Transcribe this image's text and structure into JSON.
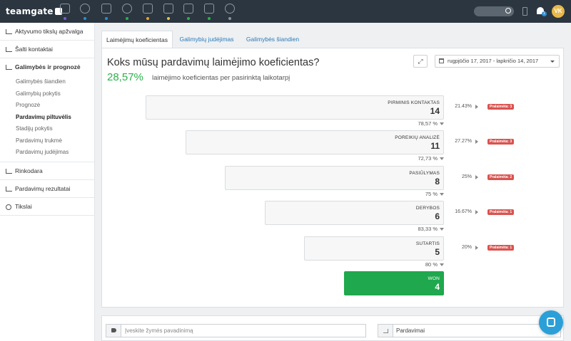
{
  "app": {
    "logo": "teamgate"
  },
  "topbar": {
    "nav_icons": [
      {
        "name": "dashboard-icon",
        "dot": "#7b5bd6"
      },
      {
        "name": "target-icon",
        "dot": "#2a8fd6"
      },
      {
        "name": "book-icon",
        "dot": "#2a8fd6"
      },
      {
        "name": "chart-pie-icon",
        "dot": "#2bb24c"
      },
      {
        "name": "briefcase-icon",
        "dot": "#e8a33a"
      },
      {
        "name": "calendar-icon",
        "dot": "#e8c93a"
      },
      {
        "name": "lock-icon",
        "dot": "#2bb24c"
      },
      {
        "name": "document-icon",
        "dot": "#2bb24c"
      },
      {
        "name": "globe-icon",
        "dot": "#8b96a1"
      }
    ],
    "notification_count": "1",
    "avatar_initials": "VK"
  },
  "sidebar": {
    "sections": [
      {
        "label": "Aktyvumo tikslų apžvalga"
      },
      {
        "label": "Šalti kontaktai"
      },
      {
        "label": "Galimybės ir prognozė",
        "items": [
          {
            "label": "Galimybės šiandien"
          },
          {
            "label": "Galimybių pokytis"
          },
          {
            "label": "Prognozė"
          },
          {
            "label": "Pardavimų piltuvėlis",
            "active": true
          },
          {
            "label": "Stadijų pokytis"
          },
          {
            "label": "Pardavimų trukmė"
          },
          {
            "label": "Pardavimų judėjimas"
          }
        ]
      },
      {
        "label": "Rinkodara"
      },
      {
        "label": "Pardavimų rezultatai"
      },
      {
        "label": "Tikslai"
      }
    ]
  },
  "tabs": [
    {
      "label": "Laimėjimų koeficientas",
      "active": true
    },
    {
      "label": "Galimybių judėjimas"
    },
    {
      "label": "Galimybės šiandien"
    }
  ],
  "panel": {
    "title": "Koks mūsų pardavimų laimėjimo koeficientas?",
    "win_rate": "28,57%",
    "win_rate_desc": "laimėjimo koeficientas per pasirinktą laikotarpį",
    "date_range": "rugpjūčio 17, 2017 - lapkričio 14, 2017"
  },
  "funnel": {
    "stages": [
      {
        "name": "PIRMINIS KONTAKTAS",
        "count": "14",
        "loss_pct": "21.43%",
        "lost": "Pralaimėta: 3"
      },
      {
        "name": "POREIKIŲ ANALIZĖ",
        "count": "11",
        "loss_pct": "27.27%",
        "lost": "Pralaimėta: 3"
      },
      {
        "name": "PASIŪLYMAS",
        "count": "8",
        "loss_pct": "25%",
        "lost": "Pralaimėta: 2"
      },
      {
        "name": "DERYBOS",
        "count": "6",
        "loss_pct": "16.67%",
        "lost": "Pralaimėta: 1"
      },
      {
        "name": "SUTARTIS",
        "count": "5",
        "loss_pct": "20%",
        "lost": "Pralaimėta: 1"
      },
      {
        "name": "WON",
        "count": "4",
        "won": true
      }
    ],
    "conversions": [
      "78,57 %",
      "72,73 %",
      "75 %",
      "83,33 %",
      "80 %"
    ]
  },
  "filters": {
    "tag_placeholder": "Įveskite žymės pavadinimą",
    "metric_select": "Pardavimai"
  },
  "colors": {
    "topbar": "#2c3640",
    "won": "#1fa84d",
    "win_rate": "#2bb24c",
    "lost_badge": "#d9534f",
    "link": "#2a7ab9",
    "chat": "#2b9fd8"
  }
}
